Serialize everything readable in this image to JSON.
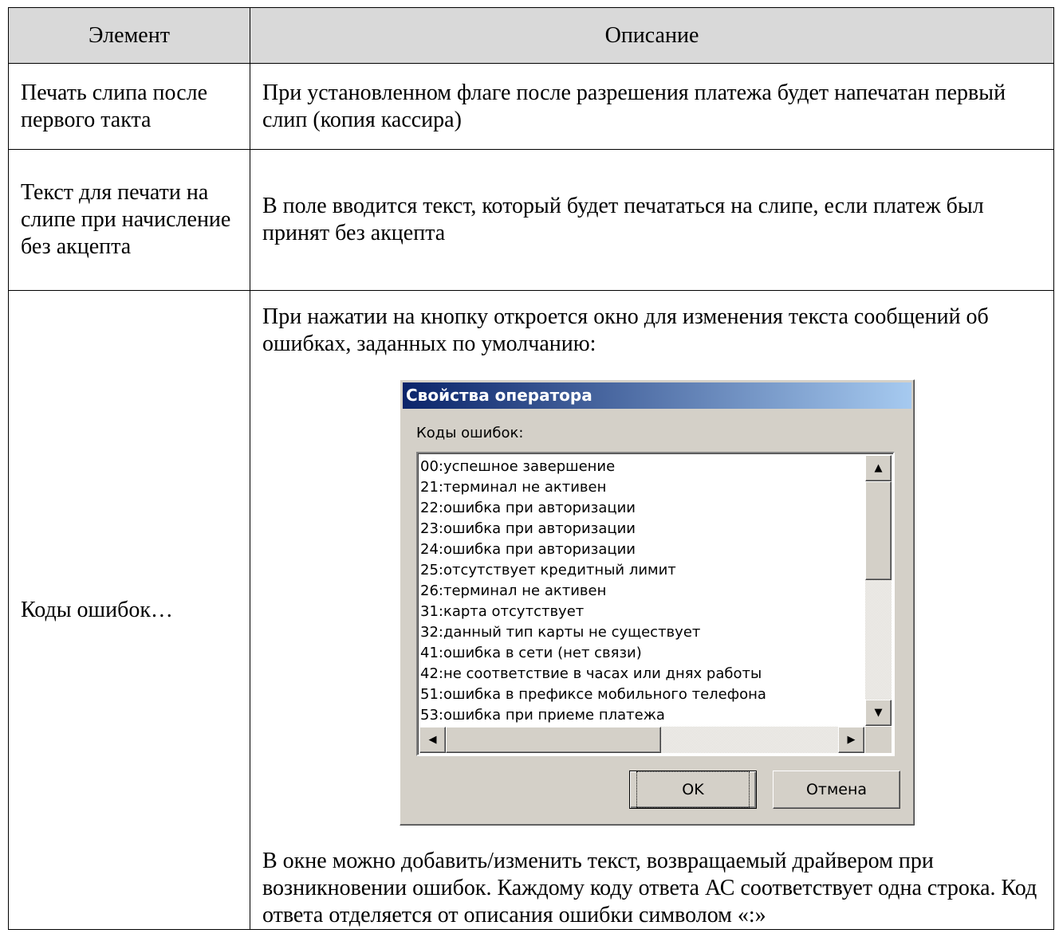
{
  "table": {
    "header": {
      "col1": "Элемент",
      "col2": "Описание"
    },
    "rows": [
      {
        "element": "Печать слипа после первого такта",
        "description": "При установленном флаге после разрешения платежа будет напечатан первый слип (копия кассира)"
      },
      {
        "element": "Текст для печати на слипе при начисление без акцепта",
        "description": "В поле вводится текст, который будет печататься на слипе, если платеж был принят без акцепта"
      },
      {
        "element": "Коды ошибок…",
        "description_before": "При нажатии на кнопку откроется окно для изменения текста сообщений об ошибках, заданных по умолчанию:",
        "description_after": "В окне можно добавить/изменить текст, возвращаемый драйвером при возникновении ошибок. Каждому коду ответа АС соответствует одна строка. Код ответа отделяется от описания ошибки символом «:»"
      }
    ]
  },
  "dialog": {
    "title": "Свойства оператора",
    "list_label": "Коды ошибок:",
    "items": [
      "00:успешное завершение",
      "21:терминал не активен",
      "22:ошибка при авторизации",
      "23:ошибка при авторизации",
      "24:ошибка при авторизации",
      "25:отсутствует кредитный лимит",
      "26:терминал не активен",
      "31:карта отсутствует",
      "32:данный тип карты не существует",
      "41:ошибка в сети (нет связи)",
      "42:не соответствие в часах или днях работы",
      "51:ошибка в префиксе мобильного телефона",
      "53:ошибка при приеме платежа"
    ],
    "ok_label": "OK",
    "cancel_label": "Отмена",
    "colors": {
      "title_start": "#0a246a",
      "title_end": "#a6caf0",
      "face": "#d4d0c8"
    }
  }
}
